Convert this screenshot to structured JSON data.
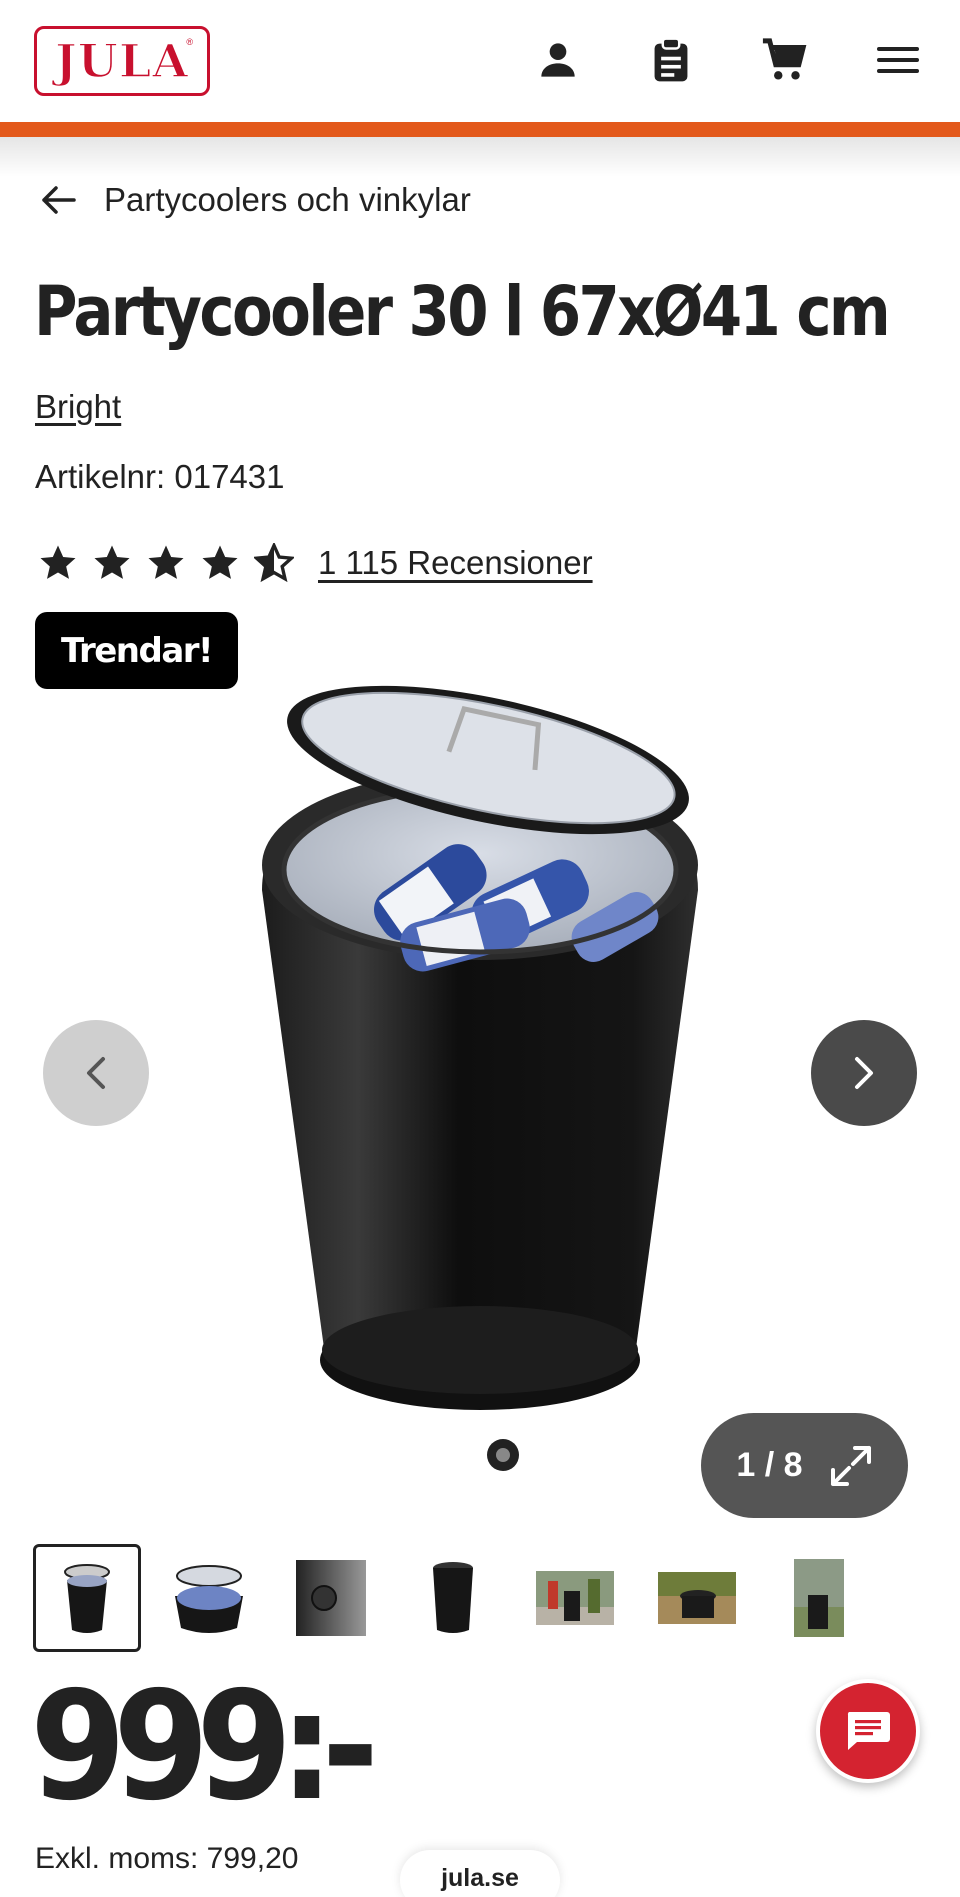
{
  "header": {
    "logo_text": "JULA",
    "logo_registered": "®",
    "brand_color": "#c8102e",
    "accent_bar_color": "#e3591b",
    "icons": [
      "account-icon",
      "shopping-list-icon",
      "cart-icon",
      "menu-icon"
    ]
  },
  "breadcrumb": {
    "label": "Partycoolers och vinkylar"
  },
  "product": {
    "title": "Partycooler 30 l 67xØ41 cm",
    "brand": "Bright",
    "sku_label": "Artikelnr: 017431",
    "rating": 4.5,
    "rating_max": 5,
    "reviews_label": "1 115 Recensioner",
    "badge": "Trendar!"
  },
  "gallery": {
    "counter": "1 / 8",
    "current": 1,
    "total": 8,
    "thumbnails": [
      {
        "name": "product-thumb-front"
      },
      {
        "name": "product-thumb-open-lid"
      },
      {
        "name": "product-thumb-thermostat"
      },
      {
        "name": "product-thumb-closed"
      },
      {
        "name": "product-thumb-party-scene"
      },
      {
        "name": "product-thumb-garden-table"
      },
      {
        "name": "product-thumb-outdoor"
      }
    ]
  },
  "price": {
    "amount": "999:-",
    "ex_vat": "Exkl. moms: 799,20"
  },
  "footer": {
    "domain": "jula.se"
  }
}
